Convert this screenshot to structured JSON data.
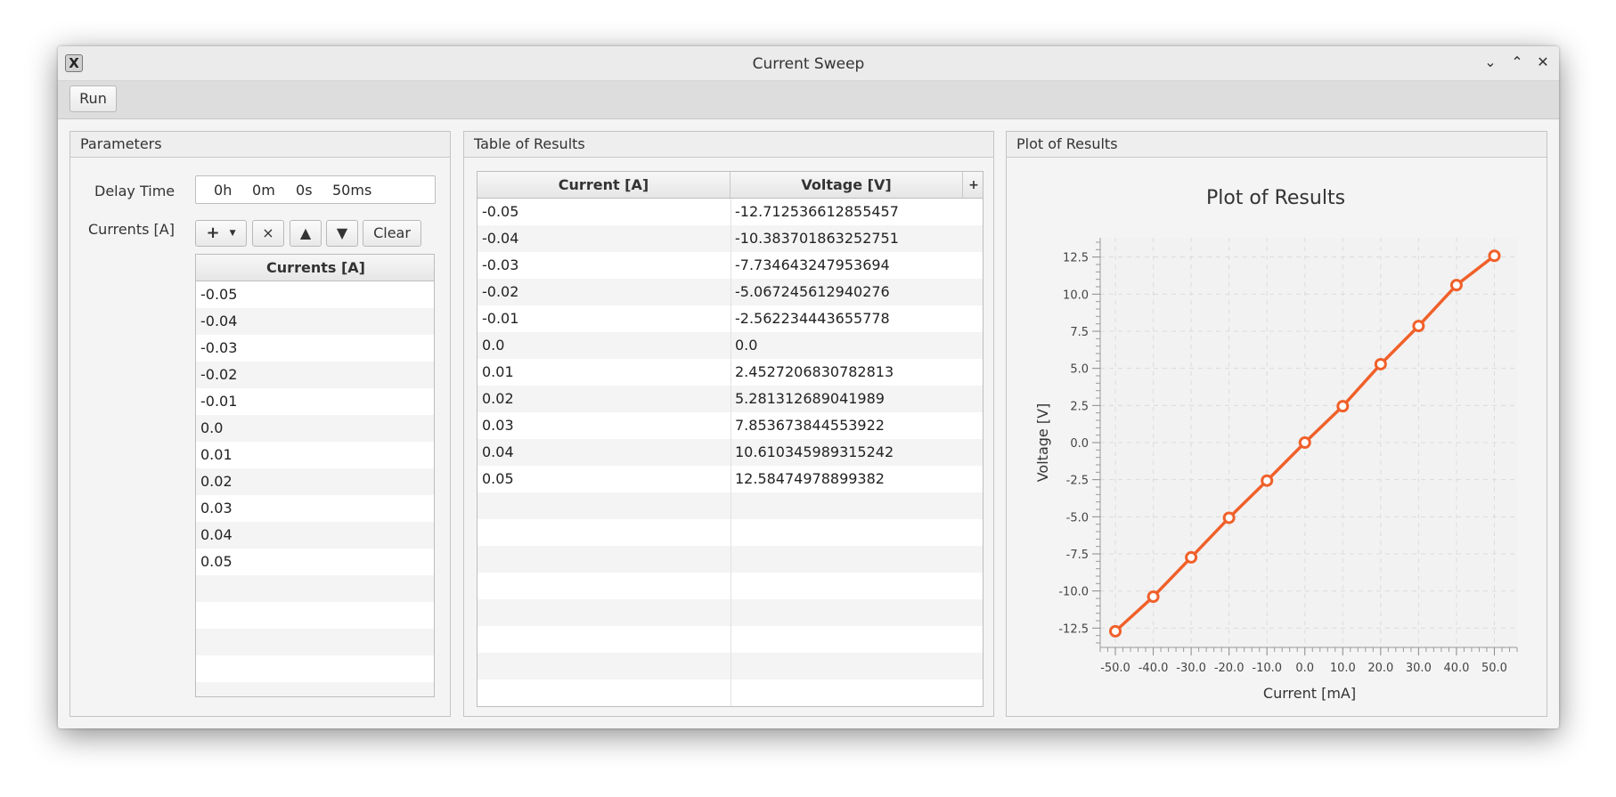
{
  "window": {
    "title": "Current Sweep"
  },
  "toolbar": {
    "run_label": "Run"
  },
  "parameters": {
    "header": "Parameters",
    "delay_label": "Delay Time",
    "delay": {
      "h": "0",
      "h_unit": "h",
      "m": "0",
      "m_unit": "m",
      "s": "0",
      "s_unit": "s",
      "ms": "50",
      "ms_unit": "ms"
    },
    "currents_label": "Currents [A]",
    "add_icon": "+",
    "remove_icon": "×",
    "up_icon": "▲",
    "down_icon": "▼",
    "clear_label": "Clear",
    "table_header": "Currents [A]",
    "values": [
      "-0.05",
      "-0.04",
      "-0.03",
      "-0.02",
      "-0.01",
      "0.0",
      "0.01",
      "0.02",
      "0.03",
      "0.04",
      "0.05"
    ]
  },
  "results_table": {
    "header": "Table of Results",
    "col_current": "Current [A]",
    "col_voltage": "Voltage [V]",
    "add_col_icon": "+",
    "rows": [
      [
        "-0.05",
        "-12.712536612855457"
      ],
      [
        "-0.04",
        "-10.383701863252751"
      ],
      [
        "-0.03",
        "-7.734643247953694"
      ],
      [
        "-0.02",
        "-5.067245612940276"
      ],
      [
        "-0.01",
        "-2.562234443655778"
      ],
      [
        "0.0",
        "0.0"
      ],
      [
        "0.01",
        "2.4527206830782813"
      ],
      [
        "0.02",
        "5.281312689041989"
      ],
      [
        "0.03",
        "7.853673844553922"
      ],
      [
        "0.04",
        "10.610345989315242"
      ],
      [
        "0.05",
        "12.58474978899382"
      ]
    ]
  },
  "plot_panel": {
    "header": "Plot of Results"
  },
  "chart_data": {
    "type": "line",
    "title": "Plot of Results",
    "xlabel": "Current [mA]",
    "ylabel": "Voltage [V]",
    "x": [
      -50,
      -40,
      -30,
      -20,
      -10,
      0,
      10,
      20,
      30,
      40,
      50
    ],
    "y": [
      -12.712536612855457,
      -10.383701863252751,
      -7.734643247953694,
      -5.067245612940276,
      -2.562234443655778,
      0.0,
      2.4527206830782813,
      5.281312689041989,
      7.853673844553922,
      10.610345989315242,
      12.58474978899382
    ],
    "xlim": [
      -54,
      56
    ],
    "ylim": [
      -13.8,
      13.8
    ],
    "xticks": [
      -50,
      -40,
      -30,
      -20,
      -10,
      0,
      10,
      20,
      30,
      40,
      50
    ],
    "xtick_labels": [
      "-50.0",
      "-40.0",
      "-30.0",
      "-20.0",
      "-10.0",
      "0.0",
      "10.0",
      "20.0",
      "30.0",
      "40.0",
      "50.0"
    ],
    "yticks": [
      -12.5,
      -10,
      -7.5,
      -5,
      -2.5,
      0,
      2.5,
      5,
      7.5,
      10,
      12.5
    ],
    "ytick_labels": [
      "-12.5",
      "-10.0",
      "-7.5",
      "-5.0",
      "-2.5",
      "0.0",
      "2.5",
      "5.0",
      "7.5",
      "10.0",
      "12.5"
    ],
    "grid": true,
    "legend": false,
    "color": "#f0602a"
  }
}
